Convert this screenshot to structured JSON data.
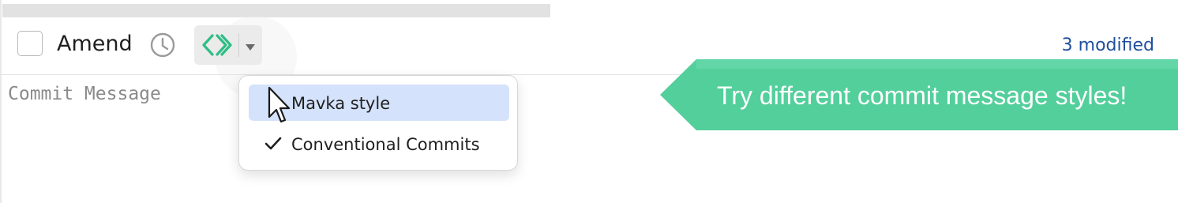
{
  "toolbar": {
    "amend_label": "Amend",
    "amend_checked": false,
    "modified_status": "3 modified"
  },
  "commit_message": {
    "placeholder": "Commit Message",
    "value": ""
  },
  "style_menu": {
    "items": [
      {
        "label": "Mavka style",
        "checked": false,
        "highlighted": true
      },
      {
        "label": "Conventional Commits",
        "checked": true,
        "highlighted": false
      }
    ]
  },
  "callout": {
    "text": "Try different commit message styles!"
  },
  "icons": {
    "history": "clock-history-icon",
    "ai": "ai-diamond-icon",
    "caret": "caret-down-icon",
    "check": "checkmark-icon",
    "cursor": "mouse-pointer-icon"
  },
  "colors": {
    "accent_green": "#2ebd86",
    "callout_green": "#53cf9c",
    "link_blue": "#1f4f9c",
    "selection_blue": "#d4e2fb"
  }
}
